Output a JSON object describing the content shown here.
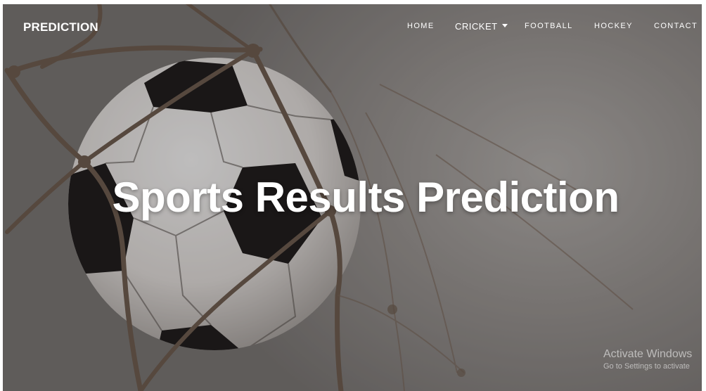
{
  "brand": {
    "name": "PREDICTION"
  },
  "nav": {
    "items": [
      {
        "label": "HOME"
      },
      {
        "label": "CRICKET",
        "has_dropdown": true
      },
      {
        "label": "FOOTBALL"
      },
      {
        "label": "HOCKEY"
      },
      {
        "label": "CONTACT"
      }
    ]
  },
  "hero": {
    "title": "Sports Results Prediction",
    "image": "soccer-ball-in-net"
  },
  "watermark": {
    "title": "Activate Windows",
    "subtitle": "Go to Settings to activate"
  },
  "colors": {
    "text": "#ffffff",
    "ball_white": "#f0eeec",
    "ball_black": "#1a1818",
    "net_rope": "#6f5e50"
  }
}
